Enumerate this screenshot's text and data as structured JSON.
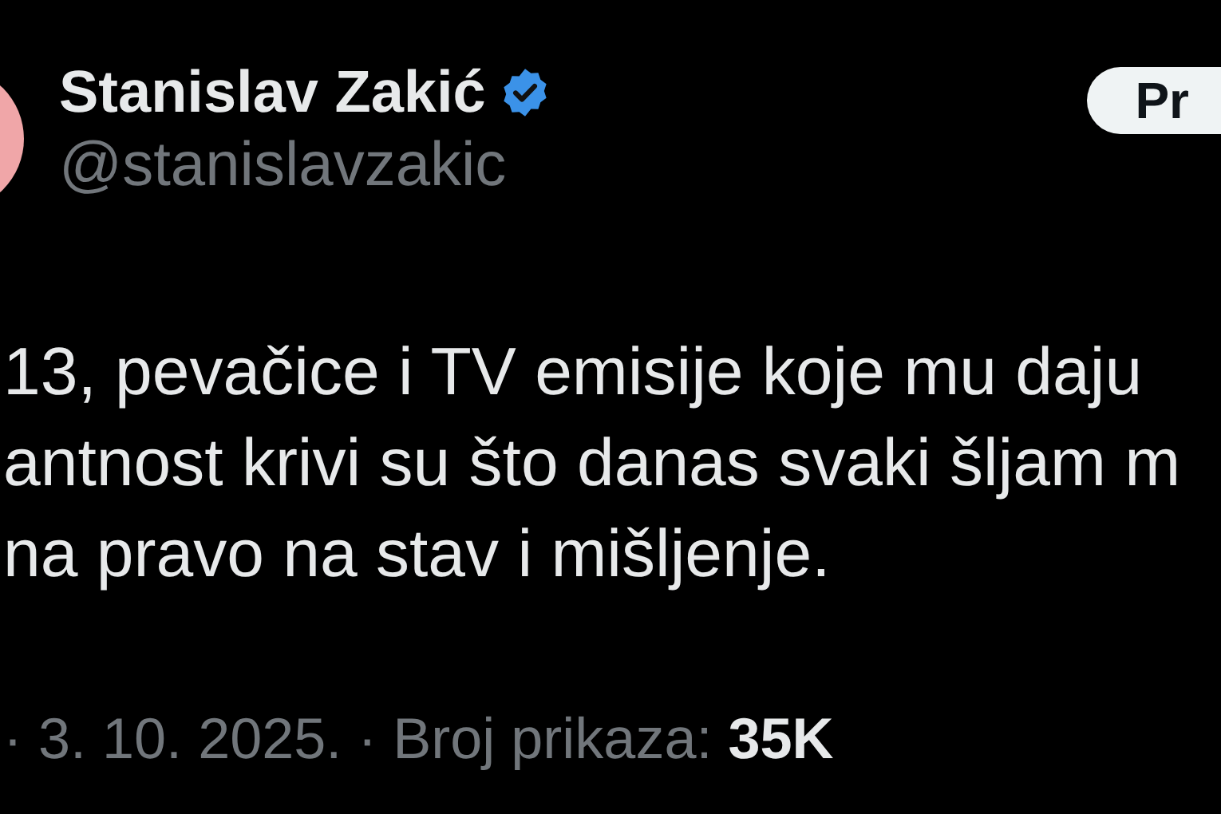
{
  "author": {
    "name": "Stanislav Zakić",
    "verified": true,
    "handle": "@stanislavzakic"
  },
  "button": {
    "label": "Pr"
  },
  "tweet": {
    "lines": [
      "13, pevačice i TV emisije koje mu daju",
      "antnost krivi su što danas svaki šljam m",
      "na pravo na stav i mišljenje."
    ]
  },
  "meta": "· 3. 10. 2025. · Broj prikaza: **35K**"
}
